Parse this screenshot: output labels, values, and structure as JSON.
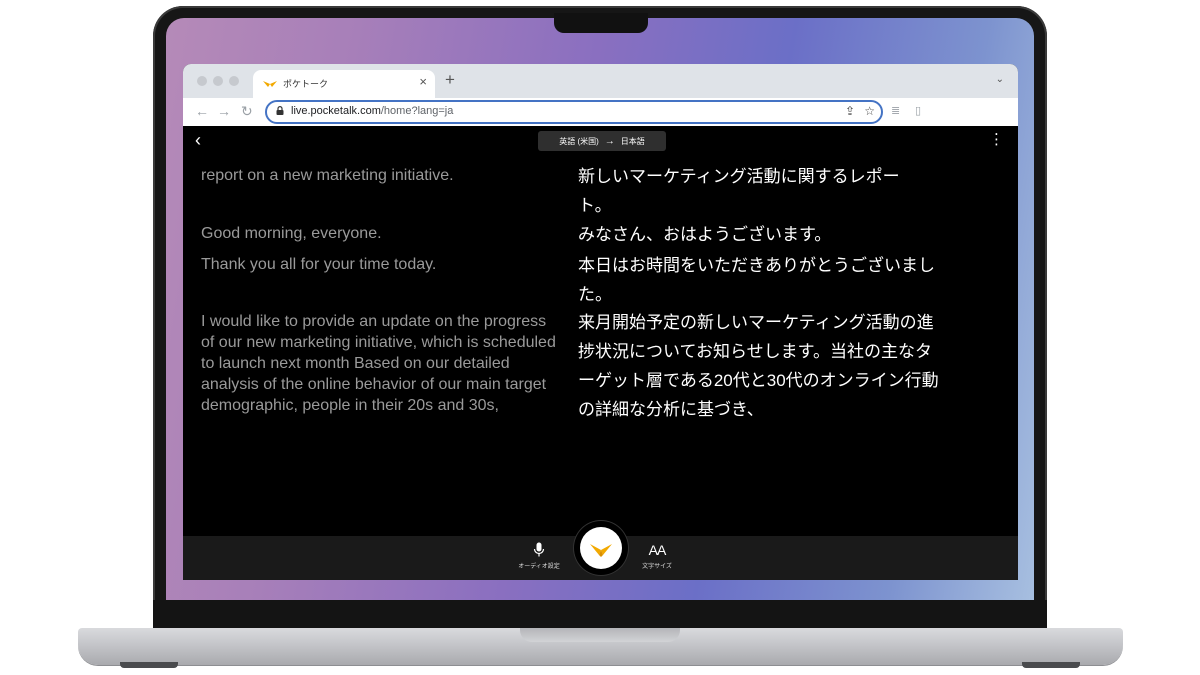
{
  "tab": {
    "title": "ポケトーク"
  },
  "address": {
    "host": "live.pocketalk.com",
    "path": "/home?lang=ja"
  },
  "app": {
    "lang_from": "英語 (米国)",
    "lang_arrow": "→",
    "lang_to": "日本語",
    "source_lines": [
      "report on a new marketing initiative.",
      "Good morning, everyone.",
      "Thank you all for your time today.",
      "I would like to provide an update on the progress of our new marketing initiative, which is scheduled to launch next month Based on our detailed analysis of the online behavior of our main target demographic, people in their 20s and 30s,"
    ],
    "target_lines": [
      "新しいマーケティング活動に関するレポート。",
      "みなさん、おはようございます。",
      "本日はお時間をいただきありがとうございました。",
      "来月開始予定の新しいマーケティング活動の進捗状況についてお知らせします。当社の主なターゲット層である20代と30代のオンライン行動の詳細な分析に基づき、"
    ],
    "audio_settings_label": "オーディオ設定",
    "font_size_label": "文字サイズ",
    "font_size_icon_text": "AA"
  },
  "colors": {
    "accent": "#f2a900",
    "omnibox_border": "#4473c4"
  }
}
